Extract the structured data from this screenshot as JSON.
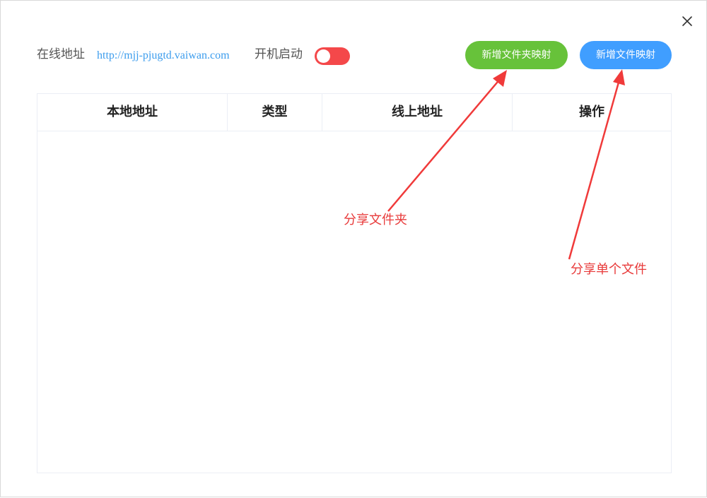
{
  "header": {
    "address_label": "在线地址",
    "address_url": "http://mjj-pjugtd.vaiwan.com",
    "autostart_label": "开机启动"
  },
  "toggle": {
    "state": "on"
  },
  "buttons": {
    "add_folder_mapping": "新增文件夹映射",
    "add_file_mapping": "新增文件映射"
  },
  "table": {
    "columns": [
      "本地地址",
      "类型",
      "线上地址",
      "操作"
    ],
    "rows": []
  },
  "annotations": {
    "folder": "分享文件夹",
    "file": "分享单个文件"
  },
  "colors": {
    "green_button": "#67c23a",
    "blue_button": "#409eff",
    "toggle": "#f4484a",
    "annotation": "#e83a3a",
    "link": "#3d9ded"
  }
}
